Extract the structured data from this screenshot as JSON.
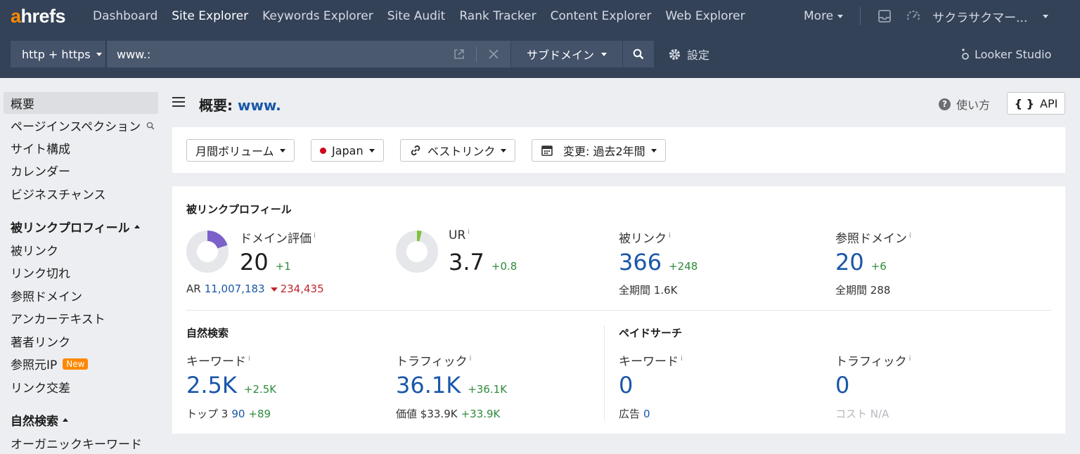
{
  "brand": {
    "logo_a": "a",
    "logo_rest": "hrefs"
  },
  "nav": {
    "items": [
      "Dashboard",
      "Site Explorer",
      "Keywords Explorer",
      "Site Audit",
      "Rank Tracker",
      "Content Explorer",
      "Web Explorer"
    ],
    "active": "Site Explorer",
    "more": "More",
    "account": "サクラサクマー..."
  },
  "search": {
    "protocol": "http + https",
    "url": "www.:",
    "mode": "サブドメイン",
    "settings": "設定",
    "looker": "Looker Studio"
  },
  "sidebar": {
    "items": [
      {
        "label": "概要",
        "active": true
      },
      {
        "label": "ページインスペクション"
      },
      {
        "label": "サイト構成"
      },
      {
        "label": "カレンダー"
      },
      {
        "label": "ビジネスチャンス"
      }
    ],
    "backlink_head": "被リンクプロフィール",
    "backlink_items": [
      "被リンク",
      "リンク切れ",
      "参照ドメイン",
      "アンカーテキスト",
      "著者リンク",
      "参照元IP",
      "リンク交差"
    ],
    "new_badge": "New",
    "organic_head": "自然検索",
    "organic_items": [
      "オーガニックキーワード"
    ]
  },
  "header": {
    "title_prefix": "概要: ",
    "domain": "www.",
    "help": "使い方",
    "api": "API"
  },
  "filters": {
    "volume": "月間ボリューム",
    "country": "Japan",
    "links": "ベストリンク",
    "change": "変更: 過去2年間"
  },
  "backlink_profile": {
    "title": "被リンクプロフィール",
    "dr": {
      "label": "ドメイン評価",
      "value": "20",
      "delta": "+1",
      "ar_label": "AR",
      "ar_value": "11,007,183",
      "ar_delta": "234,435",
      "gauge": 0.2
    },
    "ur": {
      "label": "UR",
      "value": "3.7",
      "delta": "+0.8",
      "gauge": 0.037
    },
    "backlinks": {
      "label": "被リンク",
      "value": "366",
      "delta": "+248",
      "all_label": "全期間",
      "all_value": "1.6K"
    },
    "ref_domains": {
      "label": "参照ドメイン",
      "value": "20",
      "delta": "+6",
      "all_label": "全期間",
      "all_value": "288"
    }
  },
  "organic": {
    "title": "自然検索",
    "keywords": {
      "label": "キーワード",
      "value": "2.5K",
      "delta": "+2.5K",
      "top_label": "トップ 3",
      "top_value": "90",
      "top_delta": "+89"
    },
    "traffic": {
      "label": "トラフィック",
      "value": "36.1K",
      "delta": "+36.1K",
      "value_label": "価値",
      "value_value": "$33.9K",
      "value_delta": "+33.9K"
    }
  },
  "paid": {
    "title": "ペイドサーチ",
    "keywords": {
      "label": "キーワード",
      "value": "0",
      "ads_label": "広告",
      "ads_value": "0"
    },
    "traffic": {
      "label": "トラフィック",
      "value": "0",
      "cost_label": "コスト",
      "cost_value": "N/A"
    }
  },
  "info_mark": "i",
  "colors": {
    "nav_bg": "#344258",
    "brand": "#ff8800",
    "link_blue": "#1a57a8",
    "positive": "#2e8b3c",
    "negative": "#c0262d",
    "dr_gauge": "#7b61c9",
    "ur_gauge": "#7fc241"
  }
}
